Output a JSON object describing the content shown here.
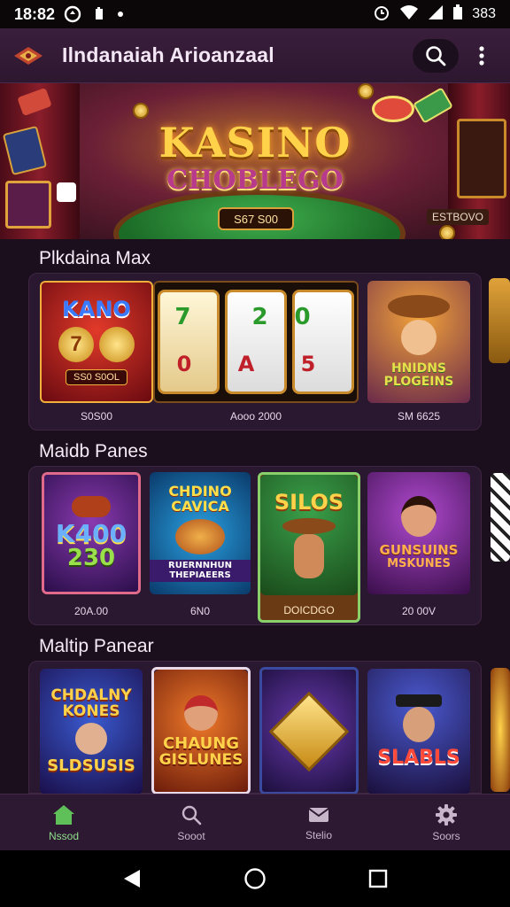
{
  "status_bar": {
    "time": "18:82",
    "battery_text": "383"
  },
  "app_bar": {
    "title": "Ilndanaiah Arioanzaal"
  },
  "banner": {
    "title": "KASINO",
    "subtitle": "CHOBLEGO",
    "plaque": "S67 S00",
    "right_label": "ESTBOVO"
  },
  "sections": [
    {
      "title": "Plkdaina Max",
      "tiles": [
        {
          "art_title": "KANO",
          "art_sub": "7",
          "art_badge": "SS0 S0OL",
          "caption": "S0S00"
        },
        {
          "art_title": "7  20",
          "art_sub": "0  A  5",
          "caption": "Aooo 2000"
        },
        {
          "art_title": "HNIDNS",
          "art_sub": "PLOGEINS",
          "caption": "SM 6625"
        }
      ]
    },
    {
      "title": "Maidb Panes",
      "tiles": [
        {
          "art_title": "K400",
          "art_sub": "230",
          "caption": "20A.00"
        },
        {
          "art_title": "CHDINO CAVICA",
          "art_sub": "RUERNNHUN THEPIAEERS",
          "caption": "6N0"
        },
        {
          "art_title": "SILOS",
          "art_sub": "",
          "caption": "DOICDGO"
        },
        {
          "art_title": "GUNSUINS",
          "art_sub": "MSKUNES",
          "caption": "20 00V"
        }
      ]
    },
    {
      "title": "Maltip Panear",
      "tiles": [
        {
          "art_title": "CHDALNY KONES",
          "art_sub": "SLDSUSIS"
        },
        {
          "art_title": "CHAUNG",
          "art_sub": "GISLUNES"
        },
        {
          "art_title": "",
          "art_sub": ""
        },
        {
          "art_title": "SLABLS",
          "art_sub": ""
        }
      ]
    }
  ],
  "bottom_nav": [
    {
      "label": "Nssod",
      "icon": "home-icon"
    },
    {
      "label": "Sooot",
      "icon": "search-icon"
    },
    {
      "label": "Stelio",
      "icon": "mail-icon"
    },
    {
      "label": "Soors",
      "icon": "gear-icon"
    }
  ],
  "colors": {
    "background": "#1b0f1d",
    "accent_green": "#8ee08a",
    "gold": "#ffd24a"
  }
}
